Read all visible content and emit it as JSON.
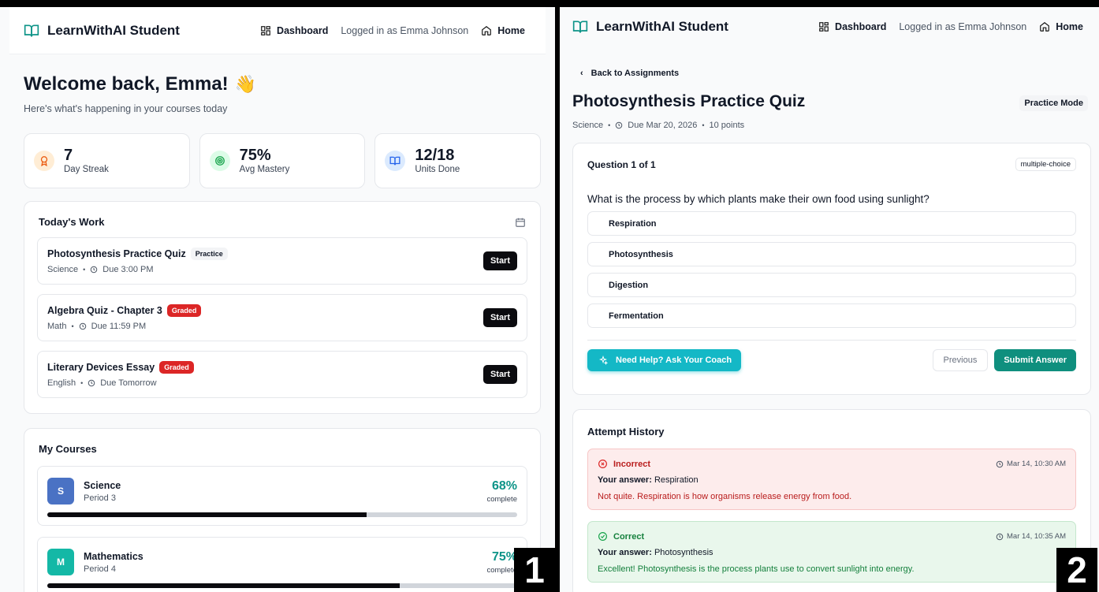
{
  "panel1": {
    "brand": "LearnWithAI Student",
    "nav": {
      "dashboard": "Dashboard",
      "user": "Logged in as Emma Johnson",
      "home": "Home"
    },
    "welcome": {
      "title": "Welcome back, Emma!",
      "emoji": "👋",
      "subtitle": "Here's what's happening in your courses today"
    },
    "stats": [
      {
        "value": "7",
        "label": "Day Streak",
        "icon": "award-icon",
        "color": "#ea580c",
        "bg": "#ffedd5"
      },
      {
        "value": "75%",
        "label": "Avg Mastery",
        "icon": "target-icon",
        "color": "#16a34a",
        "bg": "#dcfce7"
      },
      {
        "value": "12/18",
        "label": "Units Done",
        "icon": "book-icon",
        "color": "#2563eb",
        "bg": "#dbeafe"
      }
    ],
    "todays_work": {
      "title": "Today's Work",
      "items": [
        {
          "title": "Photosynthesis Practice Quiz",
          "badge": "Practice",
          "subject": "Science",
          "due": "Due 3:00 PM",
          "button": "Start"
        },
        {
          "title": "Algebra Quiz - Chapter 3",
          "badge": "Graded",
          "subject": "Math",
          "due": "Due 11:59 PM",
          "button": "Start"
        },
        {
          "title": "Literary Devices Essay",
          "badge": "Graded",
          "subject": "English",
          "due": "Due Tomorrow",
          "button": "Start"
        }
      ]
    },
    "courses": {
      "title": "My Courses",
      "items": [
        {
          "initial": "S",
          "name": "Science",
          "period": "Period 3",
          "percent": "68%",
          "progress": 0.68,
          "label": "complete",
          "color": "#4a72c4"
        },
        {
          "initial": "M",
          "name": "Mathematics",
          "period": "Period 4",
          "percent": "75%",
          "progress": 0.75,
          "label": "complete",
          "color": "#14b8a6"
        }
      ]
    },
    "corner": "1"
  },
  "panel2": {
    "brand": "LearnWithAI Student",
    "nav": {
      "dashboard": "Dashboard",
      "user": "Logged in as Emma Johnson",
      "home": "Home"
    },
    "back": "Back to Assignments",
    "quiz_title": "Photosynthesis Practice Quiz",
    "mode": "Practice Mode",
    "meta": {
      "subject": "Science",
      "due": "Due Mar 20, 2026",
      "points": "10 points"
    },
    "question": {
      "number": "Question 1 of 1",
      "type": "multiple-choice",
      "text": "What is the process by which plants make their own food using sunlight?",
      "options": [
        "Respiration",
        "Photosynthesis",
        "Digestion",
        "Fermentation"
      ],
      "coach_button": "Need Help? Ask Your Coach",
      "prev_button": "Previous",
      "submit_button": "Submit Answer"
    },
    "history": {
      "title": "Attempt History",
      "answer_label": "Your answer:",
      "attempts": [
        {
          "status": "Incorrect",
          "time": "Mar 14, 10:30 AM",
          "answer": "Respiration",
          "feedback": "Not quite. Respiration is how organisms release energy from food."
        },
        {
          "status": "Correct",
          "time": "Mar 14, 10:35 AM",
          "answer": "Photosynthesis",
          "feedback": "Excellent! Photosynthesis is the process plants use to convert sunlight into energy."
        }
      ]
    },
    "corner": "2"
  }
}
